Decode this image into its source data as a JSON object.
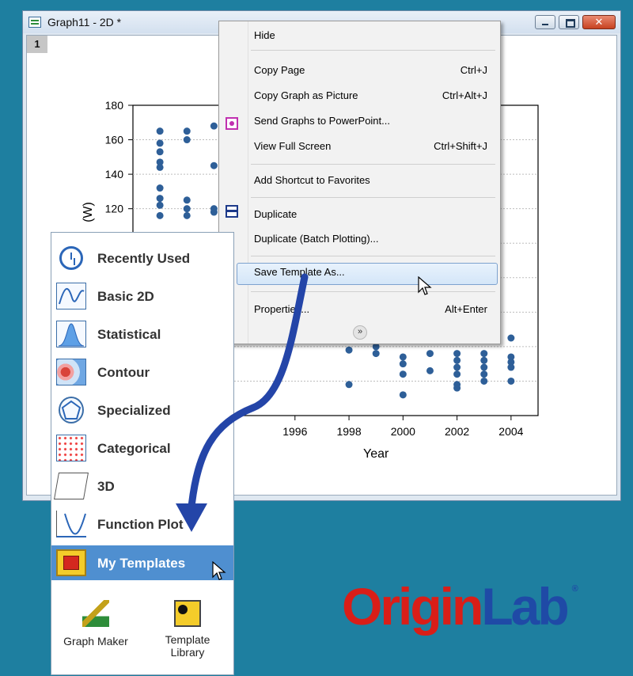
{
  "window": {
    "title": "Graph11 - 2D *",
    "page_tab": "1",
    "close_glyph": "✕"
  },
  "chart_data": {
    "type": "scatter",
    "title": "",
    "xlabel": "Year",
    "ylabel": "(W)",
    "ylabel_note": "axis label partially hidden behind gallery panel",
    "y_ticks": [
      120,
      140,
      160,
      180
    ],
    "x_ticks": [
      1996,
      1998,
      2000,
      2002,
      2004
    ],
    "ylim": [
      0,
      180
    ],
    "xlim": [
      1990,
      2005
    ],
    "grid": true,
    "point_color": "#2e5f98",
    "series": [
      {
        "values": [
          {
            "x": 1991,
            "y": [
              165,
              158,
              153,
              147,
              144,
              132,
              126,
              122,
              116
            ]
          },
          {
            "x": 1992,
            "y": [
              165,
              160,
              125,
              120,
              116
            ]
          },
          {
            "x": 1993,
            "y": [
              168,
              145,
              120,
              118
            ]
          },
          {
            "x": 1998,
            "y": [
              38,
              18
            ]
          },
          {
            "x": 1999,
            "y": [
              40,
              36
            ]
          },
          {
            "x": 2000,
            "y": [
              34,
              30,
              24,
              12
            ]
          },
          {
            "x": 2001,
            "y": [
              36,
              26
            ]
          },
          {
            "x": 2002,
            "y": [
              36,
              32,
              28,
              24,
              18,
              16
            ]
          },
          {
            "x": 2003,
            "y": [
              36,
              32,
              28,
              24,
              20
            ]
          },
          {
            "x": 2004,
            "y": [
              45,
              34,
              31,
              28,
              20
            ]
          }
        ]
      }
    ]
  },
  "context_menu": {
    "items": [
      {
        "label": "Hide",
        "shortcut": ""
      },
      {
        "label": "Copy Page",
        "shortcut": "Ctrl+J"
      },
      {
        "label": "Copy Graph as Picture",
        "shortcut": "Ctrl+Alt+J"
      },
      {
        "label": "Send Graphs to PowerPoint...",
        "shortcut": ""
      },
      {
        "label": "View Full Screen",
        "shortcut": "Ctrl+Shift+J"
      },
      {
        "label": "Add Shortcut to Favorites",
        "shortcut": ""
      },
      {
        "label": "Duplicate",
        "shortcut": ""
      },
      {
        "label": "Duplicate (Batch Plotting)...",
        "shortcut": ""
      },
      {
        "label": "Save Template As...",
        "shortcut": ""
      },
      {
        "label": "Properties...",
        "shortcut": "Alt+Enter"
      }
    ],
    "more_glyph": "»"
  },
  "gallery": {
    "items": [
      {
        "label": "Recently Used",
        "icon": "clock-icon"
      },
      {
        "label": "Basic 2D",
        "icon": "line-plot-icon"
      },
      {
        "label": "Statistical",
        "icon": "histogram-icon"
      },
      {
        "label": "Contour",
        "icon": "contour-icon"
      },
      {
        "label": "Specialized",
        "icon": "polar-icon"
      },
      {
        "label": "Categorical",
        "icon": "categorical-scatter-icon"
      },
      {
        "label": "3D",
        "icon": "cube-icon"
      },
      {
        "label": "Function Plot",
        "icon": "function-icon"
      },
      {
        "label": "My Templates",
        "icon": "folder-template-icon"
      }
    ],
    "tools": [
      {
        "label": "Graph Maker",
        "icon": "graph-maker-icon"
      },
      {
        "label": "Template Library",
        "icon": "template-library-icon"
      }
    ]
  },
  "logo": {
    "text": "OriginLab",
    "mark": "®"
  },
  "colors": {
    "background": "#1e7fa0",
    "selected": "#4f8fd0",
    "arrow": "#2445a8",
    "logo_red": "#d91e18",
    "logo_blue": "#1f4aa6"
  }
}
